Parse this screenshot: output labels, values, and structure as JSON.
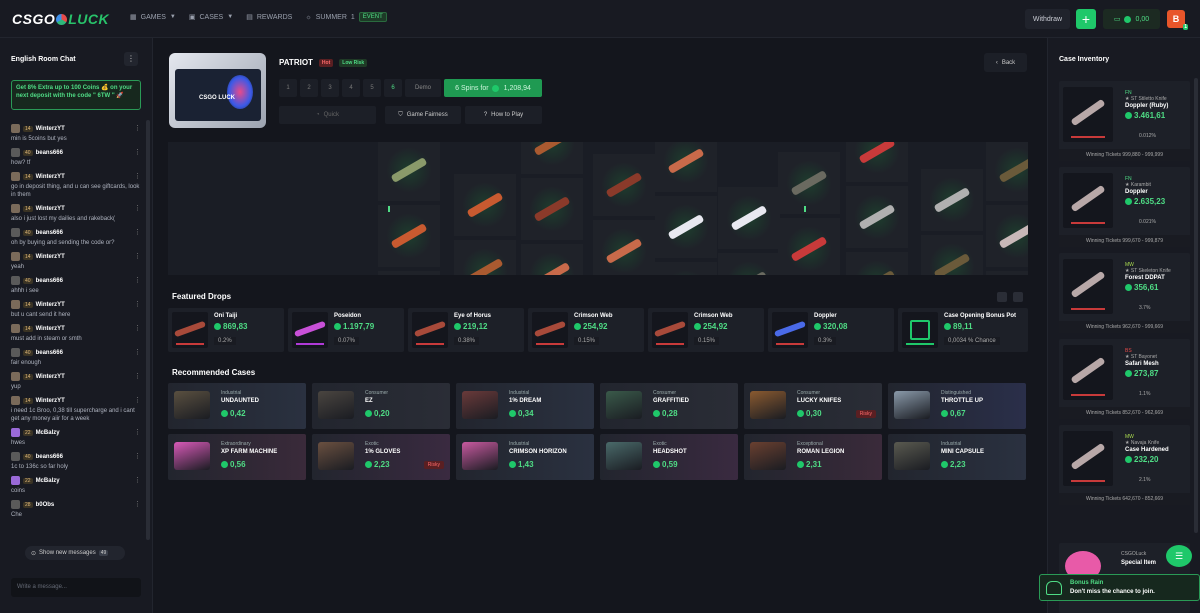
{
  "brand": {
    "a": "CSGO",
    "b": "LUCK"
  },
  "nav": [
    {
      "label": "GAMES",
      "icon": "grid-icon",
      "chev": true
    },
    {
      "label": "CASES",
      "icon": "case-icon",
      "chev": true
    },
    {
      "label": "REWARDS",
      "icon": "gift-icon",
      "chev": false
    },
    {
      "label": "SUMMER",
      "icon": "sun-icon",
      "chev": false
    }
  ],
  "nav_summer_count": "1",
  "nav_event": "EVENT",
  "top": {
    "withdraw": "Withdraw",
    "plus": "+",
    "balance": "0,00",
    "avatar": "B",
    "level": "1"
  },
  "chat": {
    "title": "English Room Chat",
    "promo": "Get 8% Extra up to 100 Coins 💰 on your next deposit with the code \" 6TW \" 🚀",
    "show_new": "Show new messages",
    "new_count": "49",
    "placeholder": "Write a message...",
    "messages": [
      {
        "name": "WinterzYT",
        "level": "14",
        "text": "min is 5coins but yes",
        "color": "#7a6a5a"
      },
      {
        "name": "beans666",
        "level": "40",
        "text": "how? tf",
        "color": "#5a5a5a"
      },
      {
        "name": "WinterzYT",
        "level": "14",
        "text": "go in deposit thing, and u can see giftcards, look in them",
        "color": "#7a6a5a"
      },
      {
        "name": "WinterzYT",
        "level": "14",
        "text": "also i just lost my dailies and rakeback(",
        "color": "#7a6a5a"
      },
      {
        "name": "beans666",
        "level": "40",
        "text": "oh by buying and sending the code or?",
        "color": "#5a5a5a"
      },
      {
        "name": "WinterzYT",
        "level": "14",
        "text": "yeah",
        "color": "#7a6a5a"
      },
      {
        "name": "beans666",
        "level": "40",
        "text": "ahhh i see",
        "color": "#5a5a5a"
      },
      {
        "name": "WinterzYT",
        "level": "14",
        "text": "but u cant send it here",
        "color": "#7a6a5a"
      },
      {
        "name": "WinterzYT",
        "level": "14",
        "text": "must add in steam or smth",
        "color": "#7a6a5a"
      },
      {
        "name": "beans666",
        "level": "40",
        "text": "fair enough",
        "color": "#5a5a5a"
      },
      {
        "name": "WinterzYT",
        "level": "14",
        "text": "yup",
        "color": "#7a6a5a"
      },
      {
        "name": "WinterzYT",
        "level": "14",
        "text": "i need 1c Broo, 0,38 till supercharge and i cant get any money aiir for a week",
        "color": "#7a6a5a"
      },
      {
        "name": "McBalzy",
        "level": "22",
        "text": "hwes",
        "color": "#9a6ad8"
      },
      {
        "name": "beans666",
        "level": "40",
        "text": "1c to 136c so far holy",
        "color": "#5a5a5a"
      },
      {
        "name": "McBalzy",
        "level": "22",
        "text": "coins",
        "color": "#9a6ad8"
      },
      {
        "name": "b0Obs",
        "level": "28",
        "text": "Che",
        "color": "#5a5a5a"
      }
    ]
  },
  "case": {
    "name": "PATRIOT",
    "hot": "Hot",
    "risk": "Low Risk",
    "spins": [
      "1",
      "2",
      "3",
      "4",
      "5",
      "6"
    ],
    "demo": "Demo",
    "spin_label": "6 Spins for",
    "spin_price": "1,208,94",
    "quick": "Quick",
    "fairness": "Game Fairness",
    "howto": "How to Play",
    "back": "Back",
    "box_label": "CSGO LUCK"
  },
  "featured": {
    "title": "Featured Drops",
    "items": [
      {
        "name": "Oni Taiji",
        "price": "869,83",
        "pct": "0.2%",
        "color": "#c83a3a"
      },
      {
        "name": "Poseidon",
        "price": "1.197,79",
        "pct": "0.07%",
        "color": "#b03ad8"
      },
      {
        "name": "Eye of Horus",
        "price": "219,12",
        "pct": "0.38%",
        "color": "#c83a3a"
      },
      {
        "name": "Crimson Web",
        "price": "254,92",
        "pct": "0.15%",
        "color": "#c83a3a"
      },
      {
        "name": "Crimson Web",
        "price": "254,92",
        "pct": "0.15%",
        "color": "#c83a3a"
      },
      {
        "name": "Doppler",
        "price": "320,08",
        "pct": "0.3%",
        "color": "#c83a3a"
      },
      {
        "name": "Case Opening Bonus Pot",
        "price": "89,11",
        "pct": "0,0034 % Chance",
        "color": "#1fc86a"
      }
    ]
  },
  "recommended": {
    "title": "Recommended Cases",
    "items": [
      {
        "rarity": "Industrial",
        "name": "UNDAUNTED",
        "price": "0,42",
        "risky": "",
        "bg": "#2a3140",
        "box": "#5a5040"
      },
      {
        "rarity": "Consumer",
        "name": "EZ",
        "price": "0,20",
        "risky": "",
        "bg": "#2a2d36",
        "box": "#4a4540"
      },
      {
        "rarity": "Industrial",
        "name": "1% DREAM",
        "price": "0,34",
        "risky": "",
        "bg": "#2a3140",
        "box": "#6a3a3a"
      },
      {
        "rarity": "Consumer",
        "name": "GRAFFITIED",
        "price": "0,28",
        "risky": "",
        "bg": "#2a2d36",
        "box": "#3a5a4a"
      },
      {
        "rarity": "Consumer",
        "name": "LUCKY KNIFES",
        "price": "0,30",
        "risky": "Risky",
        "bg": "#2a2d36",
        "box": "#8a5a30"
      },
      {
        "rarity": "Distinguished",
        "name": "THROTTLE UP",
        "price": "0,67",
        "risky": "",
        "bg": "#2a2f4a",
        "box": "#8a9aaa"
      },
      {
        "rarity": "Extraordinary",
        "name": "XP FARM MACHINE",
        "price": "0,56",
        "risky": "",
        "bg": "#3a2a3a",
        "box": "#d85ab8"
      },
      {
        "rarity": "Exotic",
        "name": "1% GLOVES",
        "price": "2,23",
        "risky": "Risky",
        "bg": "#3a2a40",
        "box": "#6a5040"
      },
      {
        "rarity": "Industrial",
        "name": "CRIMSON HORIZON",
        "price": "1,43",
        "risky": "",
        "bg": "#2a3140",
        "box": "#c85aa0"
      },
      {
        "rarity": "Exotic",
        "name": "HEADSHOT",
        "price": "0,59",
        "risky": "",
        "bg": "#3a2a40",
        "box": "#4a6a6a"
      },
      {
        "rarity": "Exceptional",
        "name": "ROMAN LEGION",
        "price": "2,31",
        "risky": "",
        "bg": "#3a2a3a",
        "box": "#6a4030"
      },
      {
        "rarity": "Industrial",
        "name": "MINI CAPSULE",
        "price": "2,23",
        "risky": "",
        "bg": "#2a3140",
        "box": "#5a5a50"
      }
    ]
  },
  "inventory": {
    "title": "Case Inventory",
    "items": [
      {
        "quality": "FN",
        "sub": "★ ST Stiletto Knife",
        "name": "Doppler (Ruby)",
        "price": "3.461,61",
        "pct": "0.012%",
        "tickets": "Winning Tickets 999,880 - 999,999",
        "qcolor": "#4fdc85"
      },
      {
        "quality": "FN",
        "sub": "★ Karambit",
        "name": "Doppler",
        "price": "2.635,23",
        "pct": "0.021%",
        "tickets": "Winning Tickets 999,670 - 999,879",
        "qcolor": "#4fdc85"
      },
      {
        "quality": "MW",
        "sub": "★ ST Skeleton Knife",
        "name": "Forest DDPAT",
        "price": "356,61",
        "pct": "3.7%",
        "tickets": "Winning Tickets 962,670 - 999,669",
        "qcolor": "#a8d84f"
      },
      {
        "quality": "BS",
        "sub": "★ ST Bayonet",
        "name": "Safari Mesh",
        "price": "273,87",
        "pct": "1.1%",
        "tickets": "Winning Tickets 852,670 - 962,669",
        "qcolor": "#e84a4a"
      },
      {
        "quality": "MW",
        "sub": "★ Navaja Knife",
        "name": "Case Hardened",
        "price": "232,20",
        "pct": "2.1%",
        "tickets": "Winning Tickets 642,670 - 852,669",
        "qcolor": "#a8d84f"
      }
    ]
  },
  "special": {
    "a": "CSGOLuck",
    "b": "Special Item"
  },
  "toast": {
    "title": "Bonus Rain",
    "text": "Don't miss the chance to join."
  }
}
